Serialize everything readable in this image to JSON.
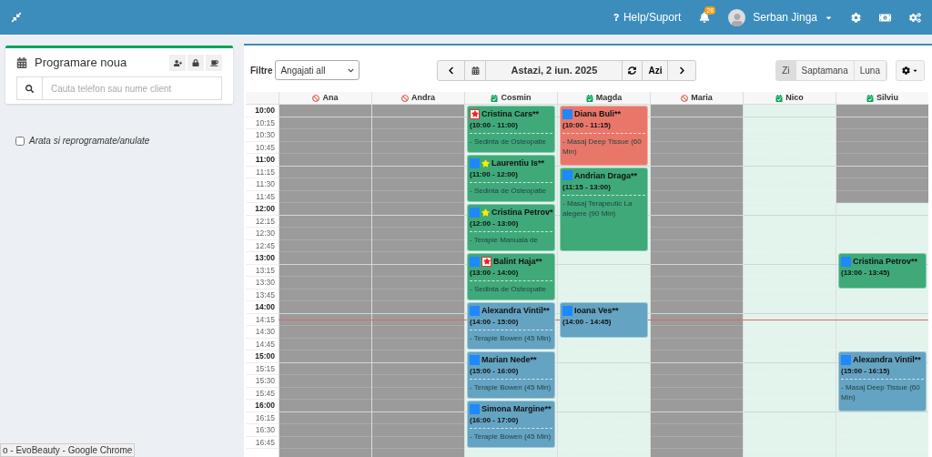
{
  "topbar": {
    "help": "Help/Suport",
    "notifications": "28",
    "user": "Serban Jinga"
  },
  "new_appointment": {
    "title": "Programare noua",
    "search_placeholder": "Cauta telefon sau nume client"
  },
  "show_rescheduled": {
    "label": "Arata si reprogramate/anulate",
    "checked": false
  },
  "toolbar": {
    "filter_label": "Filtre",
    "filter_value": "Angajati all",
    "date": "Astazi, 2 iun. 2025",
    "today": "Azi"
  },
  "views": [
    {
      "label": "Zi",
      "selected": true
    },
    {
      "label": "Saptamana",
      "selected": false
    },
    {
      "label": "Luna",
      "selected": false
    }
  ],
  "times": [
    {
      "label": "10:00",
      "kind": "hour"
    },
    {
      "label": "10:15",
      "kind": "quarter"
    },
    {
      "label": "10:30",
      "kind": "quarter"
    },
    {
      "label": "10:45",
      "kind": "quarter"
    },
    {
      "label": "11:00",
      "kind": "hour"
    },
    {
      "label": "11:15",
      "kind": "quarter"
    },
    {
      "label": "11:30",
      "kind": "quarter"
    },
    {
      "label": "11:45",
      "kind": "quarter"
    },
    {
      "label": "12:00",
      "kind": "hour"
    },
    {
      "label": "12:15",
      "kind": "quarter"
    },
    {
      "label": "12:30",
      "kind": "quarter"
    },
    {
      "label": "12:45",
      "kind": "quarter"
    },
    {
      "label": "13:00",
      "kind": "hour"
    },
    {
      "label": "13:15",
      "kind": "quarter"
    },
    {
      "label": "13:30",
      "kind": "quarter"
    },
    {
      "label": "13:45",
      "kind": "quarter"
    },
    {
      "label": "14:00",
      "kind": "hour"
    },
    {
      "label": "14:15",
      "kind": "quarter"
    },
    {
      "label": "14:30",
      "kind": "quarter"
    },
    {
      "label": "14:45",
      "kind": "quarter"
    },
    {
      "label": "15:00",
      "kind": "hour"
    },
    {
      "label": "15:15",
      "kind": "quarter"
    },
    {
      "label": "15:30",
      "kind": "quarter"
    },
    {
      "label": "15:45",
      "kind": "quarter"
    },
    {
      "label": "16:00",
      "kind": "hour"
    },
    {
      "label": "16:15",
      "kind": "quarter"
    },
    {
      "label": "16:30",
      "kind": "quarter"
    },
    {
      "label": "16:45",
      "kind": "quarter"
    }
  ],
  "columns": [
    {
      "name": "Ana",
      "available": false
    },
    {
      "name": "Andra",
      "available": false
    },
    {
      "name": "Cosmin",
      "available": true,
      "events": [
        {
          "name": "Cristina Cars**",
          "time": "(10:00 - 11:00)",
          "service": "- Sedinta de Osteopatie",
          "color": "#3fa97a",
          "badges": [
            {
              "kind": "red-star"
            }
          ]
        },
        {
          "name": "Laurentiu Is**",
          "time": "(11:00 - 12:00)",
          "service": "- Sedinta de Osteopatie",
          "color": "#3fa97a",
          "badges": [
            {
              "kind": "square"
            },
            {
              "kind": "yellow-star"
            }
          ]
        },
        {
          "name": "Cristina Petrov*",
          "time": "(12:00 - 13:00)",
          "service": "- Terapie Manuala de",
          "color": "#3fa97a",
          "badges": [
            {
              "kind": "square"
            },
            {
              "kind": "yellow-star"
            }
          ]
        },
        {
          "name": "Balint Haja**",
          "time": "(13:00 - 14:00)",
          "service": "- Sedinta de Osteopatie",
          "color": "#3fa97a",
          "badges": [
            {
              "kind": "square"
            },
            {
              "kind": "red-star"
            }
          ]
        },
        {
          "name": "Alexandra Vintil**",
          "time": "(14:00 - 15:00)",
          "service": "- Terapie Bowen (45 Min)",
          "color": "#64a3c1",
          "badges": [
            {
              "kind": "square"
            }
          ]
        },
        {
          "name": "Marian Nede**",
          "time": "(15:00 - 16:00)",
          "service": "- Terapie Bowen (45 Min)",
          "color": "#64a3c1",
          "badges": [
            {
              "kind": "square"
            }
          ]
        },
        {
          "name": "Simona Margine**",
          "time": "(16:00 - 17:00)",
          "service": "- Terapie Bowen (45 Min)",
          "color": "#64a3c1",
          "badges": [
            {
              "kind": "square"
            }
          ]
        }
      ]
    },
    {
      "name": "Magda",
      "available": true,
      "events": [
        {
          "name": "Diana Buli**",
          "time": "(10:00 - 11:15)",
          "service": "- Masaj Deep Tissue (60 Min)",
          "color": "#e8776a",
          "badges": [
            {
              "kind": "square"
            }
          ]
        },
        {
          "name": "Andrian Draga**",
          "time": "(11:15 - 13:00)",
          "service": "- Masaj Terapeutic La alegere (90 Min)",
          "color": "#3fa97a",
          "badges": [
            {
              "kind": "square"
            }
          ]
        },
        {
          "name": "Ioana Ves**",
          "time": "(14:00 - 14:45)",
          "color": "#64a3c1",
          "badges": [
            {
              "kind": "square"
            }
          ]
        }
      ]
    },
    {
      "name": "Maria",
      "available": false
    },
    {
      "name": "Nico",
      "available": true
    },
    {
      "name": "Silviu",
      "available": true,
      "slots": [
        {
          "blocked": true
        },
        {
          "blocked": true
        },
        {
          "blocked": true
        },
        {
          "blocked": true
        },
        {
          "blocked": true
        },
        {
          "blocked": true
        },
        {
          "blocked": true
        },
        {
          "blocked": true
        },
        {
          "blocked": false
        },
        {
          "blocked": false
        },
        {
          "blocked": false
        },
        {
          "blocked": false
        },
        {
          "blocked": false
        },
        {
          "blocked": false
        },
        {
          "blocked": false
        },
        {
          "blocked": false
        },
        {
          "blocked": false
        },
        {
          "blocked": false
        },
        {
          "blocked": false
        },
        {
          "blocked": false
        },
        {
          "blocked": false
        },
        {
          "blocked": false
        },
        {
          "blocked": false
        },
        {
          "blocked": false
        },
        {
          "blocked": false
        },
        {
          "blocked": false
        },
        {
          "blocked": false
        },
        {
          "blocked": false
        }
      ],
      "events": [
        {
          "name": "Cristina Petrov**",
          "time": "(13:00 - 13:45)",
          "color": "#3fa97a",
          "badges": [
            {
              "kind": "square"
            }
          ]
        },
        {
          "name": "Alexandra Vintil**",
          "time": "(15:00 - 16:15)",
          "service": "- Masaj Deep Tissue (60 Min)",
          "color": "#64a3c1",
          "badges": [
            {
              "kind": "square"
            }
          ]
        }
      ]
    }
  ],
  "browser_status": "o - EvoBeauty - Google Chrome"
}
